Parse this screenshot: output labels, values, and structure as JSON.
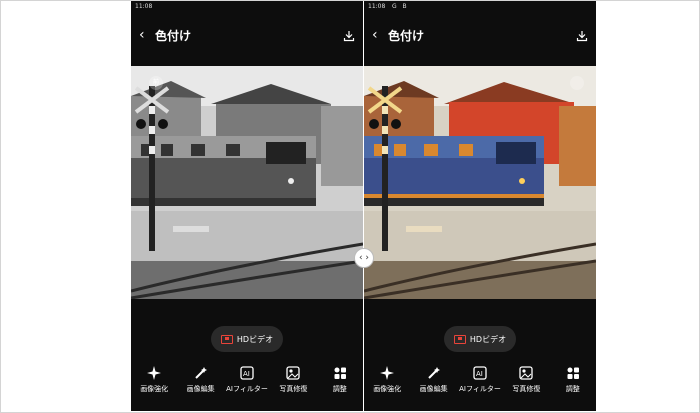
{
  "panels": [
    {
      "status": {
        "time": "11:08",
        "icons": ""
      },
      "title": "色付け",
      "badge": "前",
      "hd_label": "HDビデオ",
      "tools": [
        {
          "label": "画像強化",
          "icon": "sparkle-icon"
        },
        {
          "label": "画像編集",
          "icon": "magic-wand-icon"
        },
        {
          "label": "AIフィルター",
          "icon": "ai-filter-icon"
        },
        {
          "label": "写真修復",
          "icon": "photo-repair-icon"
        },
        {
          "label": "調整",
          "icon": "adjust-grid-icon"
        }
      ]
    },
    {
      "status": {
        "time": "11:08",
        "icons": "G B"
      },
      "title": "色付け",
      "hd_label": "HDビデオ",
      "tools": [
        {
          "label": "画像強化",
          "icon": "sparkle-icon"
        },
        {
          "label": "画像編集",
          "icon": "magic-wand-icon"
        },
        {
          "label": "AIフィルター",
          "icon": "ai-filter-icon"
        },
        {
          "label": "写真修復",
          "icon": "photo-repair-icon"
        },
        {
          "label": "調整",
          "icon": "adjust-grid-icon"
        }
      ]
    }
  ],
  "compare_handle": "‹ ›",
  "colors": {
    "phone_bg": "#0d0d0d",
    "tram_blue": "#3b4f8c",
    "tram_orange": "#d9882f",
    "house_red": "#d3452a"
  }
}
